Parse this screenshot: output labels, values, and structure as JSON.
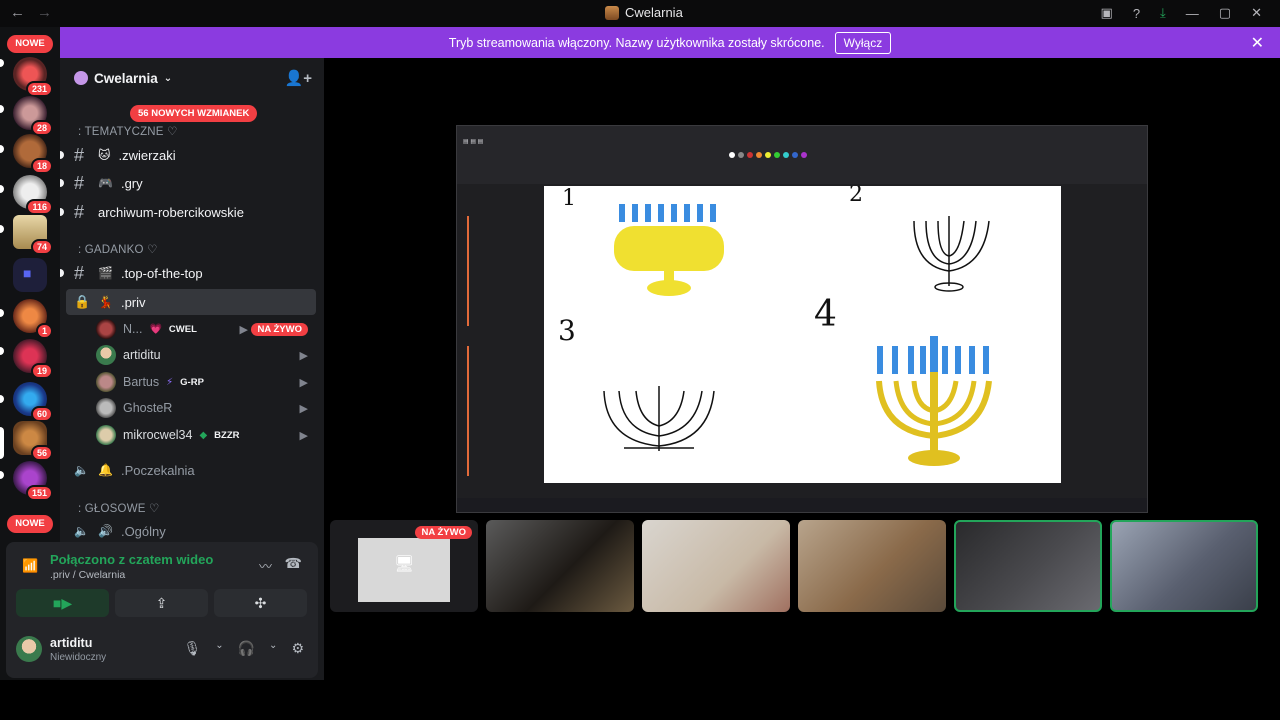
{
  "window": {
    "title": "Cwelarnia"
  },
  "banner": {
    "text": "Tryb streamowania włączony. Nazwy użytkownika zostały skrócone.",
    "button": "Wyłącz"
  },
  "rail": {
    "badge_top": "NOWE",
    "badge_bottom": "NOWE",
    "servers": [
      {
        "badge": "231"
      },
      {
        "badge": "28"
      },
      {
        "badge": "18"
      },
      {
        "badge": "116"
      },
      {
        "badge": "74"
      },
      {
        "badge": ""
      },
      {
        "badge": "1"
      },
      {
        "badge": "19"
      },
      {
        "badge": "60"
      },
      {
        "badge": "56"
      },
      {
        "badge": "151"
      }
    ]
  },
  "sidebar": {
    "guild_name": "Cwelarnia",
    "mentions_pill": "56 NOWYCH WZMIANEK",
    "categories": {
      "tematyczne": ": TEMATYCZNE ♡",
      "gadanko": ": GADANKO ♡",
      "glosowe": ": GŁOSOWE ♡"
    },
    "channels": {
      "zwierzaki": ".zwierzaki",
      "gry": ".gry",
      "archiwum": "archiwum-robercikowskie",
      "top": ".top-of-the-top",
      "priv": ".priv",
      "poczekalnia": ".Poczekalnia",
      "ogolny": ".Ogólny"
    },
    "voice_users": [
      {
        "name": "N...",
        "tag": "CWEL",
        "live": "NA ŻYWO"
      },
      {
        "name": "artiditu",
        "tag": ""
      },
      {
        "name": "Bartus",
        "tag": "G-RP"
      },
      {
        "name": "GhosteR",
        "tag": ""
      },
      {
        "name": "mikrocwel34",
        "tag": "BZZR"
      }
    ]
  },
  "voice_panel": {
    "status": "Połączono z czatem wideo",
    "location": ".priv / Cwelarnia"
  },
  "user": {
    "name": "artiditu",
    "status": "Niewidoczny"
  },
  "stage": {
    "live_label": "NA ŻYWO",
    "canvas_numbers": [
      "1",
      "2",
      "3",
      "4"
    ]
  }
}
